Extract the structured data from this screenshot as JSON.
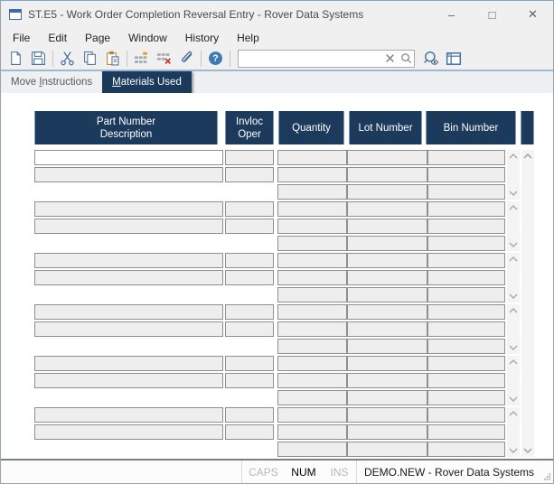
{
  "window": {
    "title": "ST.E5 - Work Order Completion Reversal Entry - Rover Data Systems",
    "controls": {
      "minimize": "–",
      "maximize": "□",
      "close": "✕"
    }
  },
  "menu": {
    "items": [
      {
        "label": "File"
      },
      {
        "label": "Edit"
      },
      {
        "label": "Page"
      },
      {
        "label": "Window"
      },
      {
        "label": "History"
      },
      {
        "label": "Help"
      }
    ]
  },
  "toolbar": {
    "icons": [
      "new-document",
      "save",
      "cut",
      "copy",
      "paste",
      "insert-row-grid",
      "delete-row-grid",
      "attachment",
      "help",
      "clear-search",
      "search",
      "lookup-view",
      "table-view"
    ],
    "search": {
      "value": "",
      "placeholder": ""
    }
  },
  "tabs": [
    {
      "pre": "Move ",
      "mnemonic": "I",
      "post": "nstructions",
      "active": false
    },
    {
      "pre": "",
      "mnemonic": "M",
      "post": "aterials Used",
      "active": true
    }
  ],
  "grid": {
    "columns": [
      {
        "line1": "Part Number",
        "line2": "Description"
      },
      {
        "line1": "Invloc",
        "line2": "Oper"
      },
      {
        "line1": "Quantity",
        "line2": ""
      },
      {
        "line1": "Lot Number",
        "line2": ""
      },
      {
        "line1": "Bin Number",
        "line2": ""
      }
    ],
    "group_count": 6,
    "rows_per_group": 3,
    "cell_values": []
  },
  "status_bar": {
    "caps": "CAPS",
    "num": "NUM",
    "ins": "INS",
    "message": "DEMO.NEW - Rover Data Systems"
  },
  "colors": {
    "header_navy": "#1b3a5c",
    "active_tab_navy": "#1b3a5c",
    "icon_blue": "#4a7199",
    "help_blue": "#3c7ab5",
    "paste_tan": "#b5823c",
    "insert_orange": "#e8a33d",
    "delete_red": "#c23b2e",
    "field_gray": "#eeeeee",
    "chrome_gray": "#f0f0f0"
  }
}
